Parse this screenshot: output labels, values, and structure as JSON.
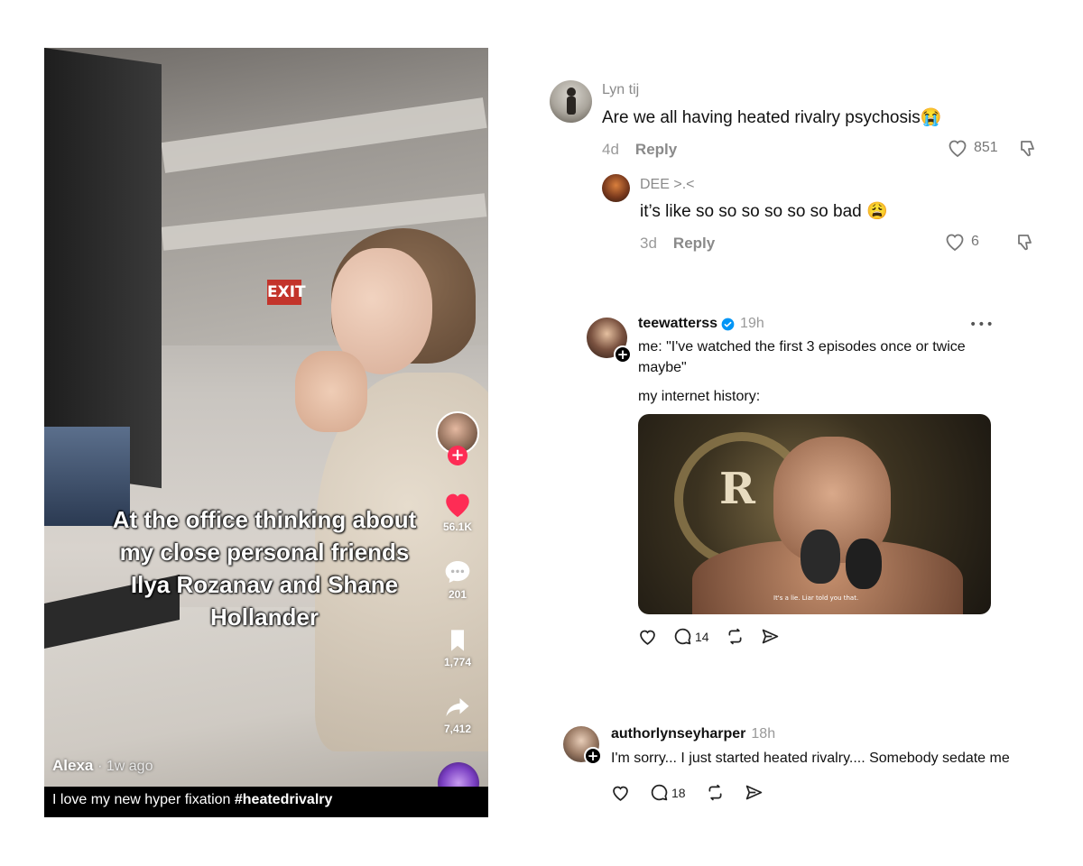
{
  "video": {
    "exit_sign": "EXIT",
    "caption": "At the office thinking about my close personal friends Ilya Rozanav and Shane Hollander",
    "likes": "56.1K",
    "comments": "201",
    "saves": "1,774",
    "shares": "7,412",
    "author": "Alexa",
    "posted": "· 1w ago",
    "description_text": "I love my new hyper fixation ",
    "description_hashtag": "#heatedrivalry",
    "follow_symbol": "+"
  },
  "comments": [
    {
      "user": "Lyn tij",
      "text": "Are we all having heated rivalry psychosis😭",
      "age": "4d",
      "reply_label": "Reply",
      "likes": "851"
    },
    {
      "user": "DEE >.<",
      "text": "it’s like so so so so so so bad 😩",
      "age": "3d",
      "reply_label": "Reply",
      "likes": "6"
    }
  ],
  "threads": [
    {
      "user": "teewatterss",
      "time": "19h",
      "more": "•••",
      "line1": "me: \"I've watched the first 3 episodes once or twice maybe\"",
      "line2": "my internet history:",
      "thumb_letter": "R",
      "thumb_subtitle": "It's a lie. Liar told you that.",
      "replies": "14"
    },
    {
      "user": "authorlynseyharper",
      "time": "18h",
      "text": "I'm sorry... I just started heated rivalry.... Somebody sedate me",
      "replies": "18"
    }
  ]
}
